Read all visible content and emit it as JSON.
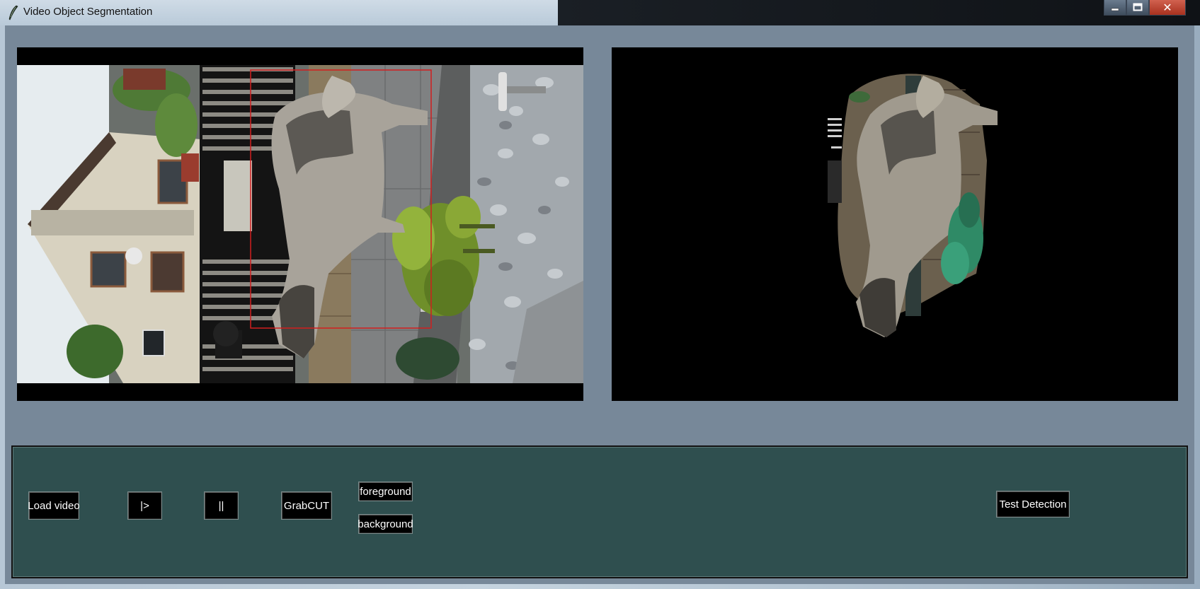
{
  "window": {
    "title": "Video Object Segmentation",
    "icon": "feather-icon",
    "controls": {
      "minimize_icon": "minimize-icon",
      "maximize_icon": "maximize-icon",
      "close_icon": "close-icon",
      "close_glyph": "✕"
    }
  },
  "panels": {
    "left": {
      "content": "video frame: dog standing on paved path beside fence, plant and gravel, red bounding box"
    },
    "right": {
      "content": "segmented result: dog and plant on black background"
    }
  },
  "controls": {
    "load_video": "Load video",
    "play": "|>",
    "pause": "||",
    "grabcut": "GrabCUT",
    "foreground": "foreground",
    "background": "background",
    "test_detection": "Test Detection"
  },
  "colors": {
    "client_background": "#778899",
    "control_frame": "#2f4f4f",
    "button_background": "#000000",
    "bbox_color": "#d21e1e"
  }
}
